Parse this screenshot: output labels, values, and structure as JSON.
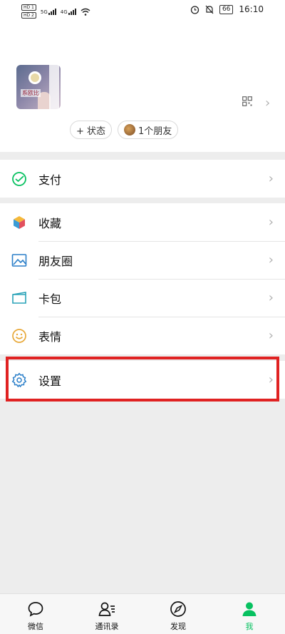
{
  "status_bar": {
    "hd1": "HD 1",
    "hd2": "HD 2",
    "net1": "5G",
    "net2": "4G",
    "battery": "66",
    "time": "16:10"
  },
  "profile": {
    "avatar_text": "系欧比",
    "status_label": "+ 状态",
    "friends_label": "1个朋友"
  },
  "menu": {
    "pay": "支付",
    "favorites": "收藏",
    "moments": "朋友圈",
    "cards": "卡包",
    "stickers": "表情",
    "settings": "设置"
  },
  "tabs": [
    {
      "label": "微信"
    },
    {
      "label": "通讯录"
    },
    {
      "label": "发现"
    },
    {
      "label": "我"
    }
  ],
  "colors": {
    "accent": "#07c160",
    "highlight": "#e02222",
    "background": "#ededed"
  }
}
